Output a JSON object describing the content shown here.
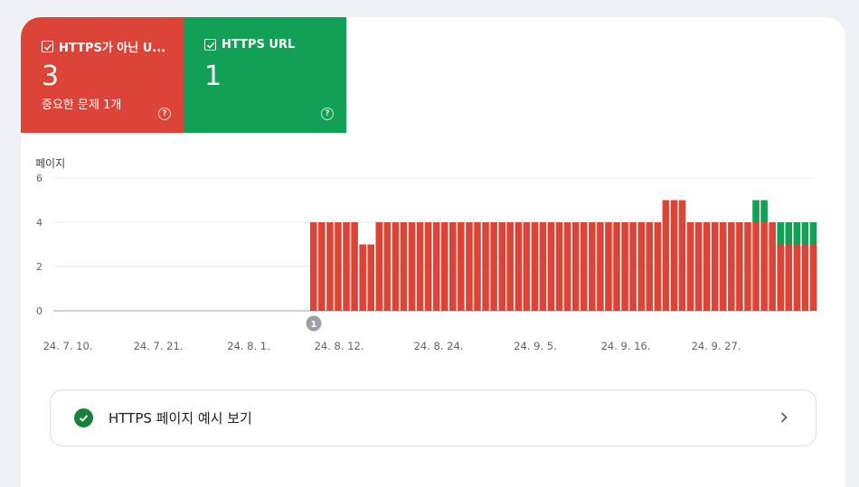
{
  "tiles": {
    "non_https": {
      "label": "HTTPS가 아닌 U...",
      "count": "3",
      "sub": "중요한 문제 1개",
      "color": "#dc4437",
      "checked": true,
      "icon": "help-icon"
    },
    "https": {
      "label": "HTTPS URL",
      "count": "1",
      "color": "#12a056",
      "checked": true,
      "icon": "help-icon"
    }
  },
  "chart_data": {
    "type": "bar",
    "stacked": true,
    "ylabel": "페이지",
    "ylim": [
      0,
      6
    ],
    "yticks": [
      "0",
      "2",
      "4",
      "6"
    ],
    "xticks": [
      "24. 7. 10.",
      "24. 7. 21.",
      "24. 8. 1.",
      "24. 8. 12.",
      "24. 8. 24.",
      "24. 9. 5.",
      "24. 9. 16.",
      "24. 9. 27."
    ],
    "annotation": "1",
    "leading_empty_days": 32,
    "series": [
      {
        "name": "HTTPS가 아닌 U...",
        "color": "#dc4437",
        "values": [
          4,
          4,
          4,
          4,
          4,
          4,
          3,
          3,
          4,
          4,
          4,
          4,
          4,
          4,
          4,
          4,
          4,
          4,
          4,
          4,
          4,
          4,
          4,
          4,
          4,
          4,
          4,
          4,
          4,
          4,
          4,
          4,
          4,
          4,
          4,
          4,
          4,
          4,
          4,
          4,
          4,
          4,
          4,
          5,
          5,
          5,
          4,
          4,
          4,
          4,
          4,
          4,
          4,
          4,
          4,
          4,
          4,
          3,
          3,
          3,
          3,
          3
        ]
      },
      {
        "name": "HTTPS URL",
        "color": "#12a056",
        "values": [
          0,
          0,
          0,
          0,
          0,
          0,
          0,
          0,
          0,
          0,
          0,
          0,
          0,
          0,
          0,
          0,
          0,
          0,
          0,
          0,
          0,
          0,
          0,
          0,
          0,
          0,
          0,
          0,
          0,
          0,
          0,
          0,
          0,
          0,
          0,
          0,
          0,
          0,
          0,
          0,
          0,
          0,
          0,
          0,
          0,
          0,
          0,
          0,
          0,
          0,
          0,
          0,
          0,
          0,
          1,
          1,
          0,
          1,
          1,
          1,
          1,
          1
        ]
      }
    ]
  },
  "preview": {
    "label": "HTTPS 페이지 예시 보기",
    "status_color": "#188038",
    "icon": "check-circle-icon",
    "chevron": "chevron-right-icon"
  }
}
